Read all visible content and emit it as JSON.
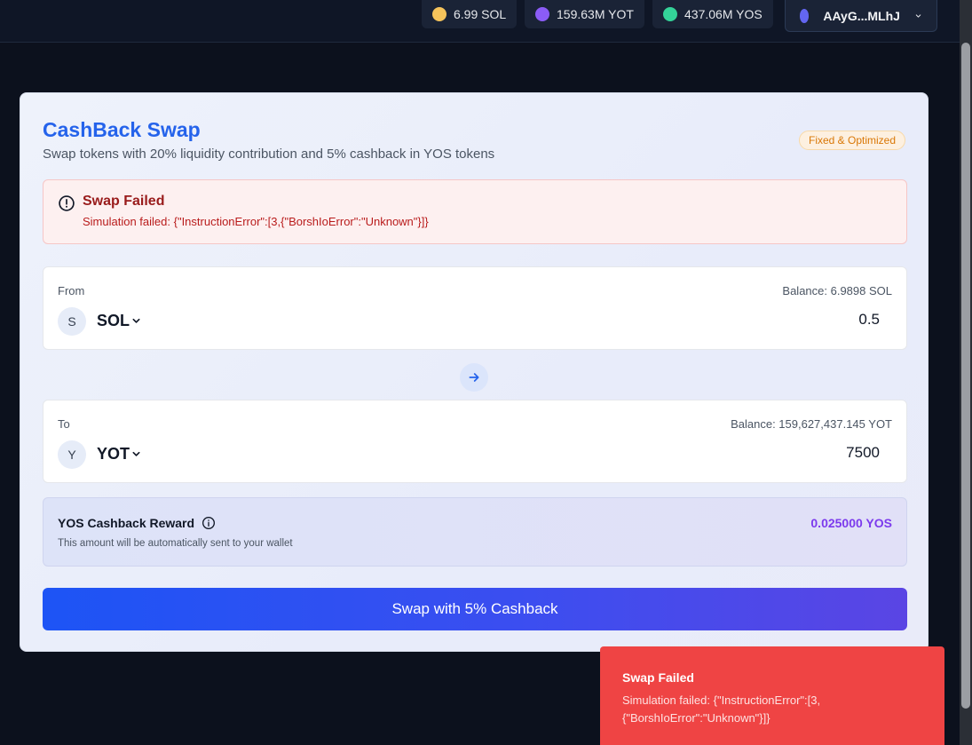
{
  "header": {
    "balances": [
      {
        "label": "6.99 SOL",
        "color": "#f5c35b",
        "icon": "sol-token-icon"
      },
      {
        "label": "159.63M YOT",
        "color": "#8b5cf6",
        "icon": "yot-token-icon"
      },
      {
        "label": "437.06M YOS",
        "color": "#34d399",
        "icon": "yos-token-icon"
      }
    ],
    "wallet": {
      "address": "AAyG...MLhJ",
      "color": "#6366f1"
    }
  },
  "card": {
    "title": "CashBack Swap",
    "subtitle": "Swap tokens with 20% liquidity contribution and 5% cashback in YOS tokens",
    "badge": "Fixed & Optimized"
  },
  "alert": {
    "title": "Swap Failed",
    "message": "Simulation failed: {\"InstructionError\":[3,{\"BorshIoError\":\"Unknown\"}]}"
  },
  "from": {
    "label": "From",
    "balance": "Balance: 6.9898 SOL",
    "avatar": "S",
    "token": "SOL",
    "amount": "0.5"
  },
  "to": {
    "label": "To",
    "balance": "Balance: 159,627,437.145 YOT",
    "avatar": "Y",
    "token": "YOT",
    "amount": "7500"
  },
  "cashback": {
    "title": "YOS Cashback Reward",
    "note": "This amount will be automatically sent to your wallet",
    "value": "0.025000 YOS"
  },
  "swap_button": "Swap with 5% Cashback",
  "toast": {
    "title": "Swap Failed",
    "message": "Simulation failed: {\"InstructionError\":[3, {\"BorshIoError\":\"Unknown\"}]}"
  },
  "colors": {
    "accent": "#2563eb",
    "error": "#ef4444",
    "cashback": "#7c3aed"
  }
}
